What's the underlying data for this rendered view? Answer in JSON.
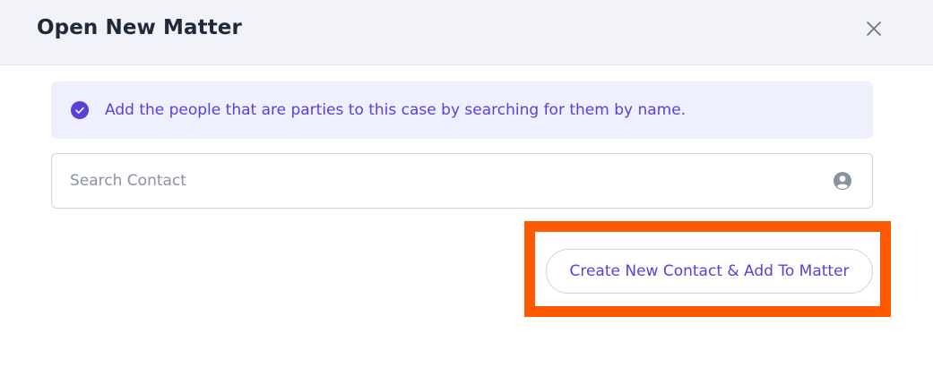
{
  "modal": {
    "title": "Open New Matter"
  },
  "info": {
    "text": "Add the people that are parties to this case by searching for them by name."
  },
  "search": {
    "placeholder": "Search Contact",
    "value": ""
  },
  "actions": {
    "create_contact_label": "Create New Contact & Add To Matter"
  },
  "icons": {
    "close": "close-icon",
    "info": "check-circle-icon",
    "search_user": "user-circle-icon"
  },
  "colors": {
    "accent": "#5b3fd6",
    "highlight": "#ff5a00",
    "header_bg": "#f1f3f8",
    "info_bg": "#eef1fd"
  }
}
